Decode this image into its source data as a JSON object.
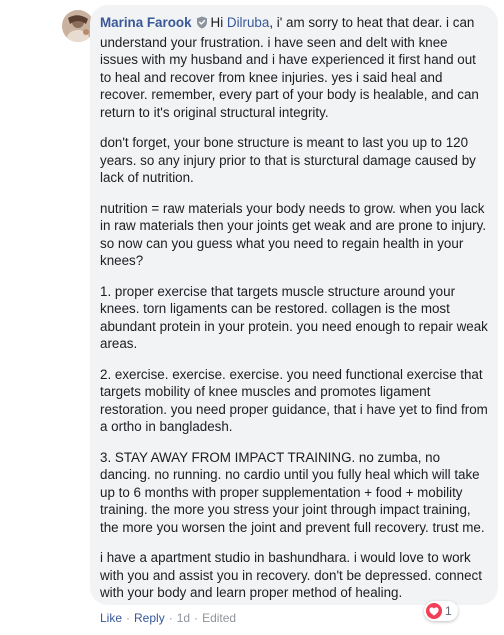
{
  "comment": {
    "author": "Marina Farook",
    "mention": "Dilruba",
    "first_line_prefix": "Hi ",
    "first_paragraph_rest": ", i' am sorry to heat that dear. i can understand your frustration. i have seen and delt with knee issues with my husband and i have experienced it first hand out to heal and recover from knee injuries. yes i said heal and recover. remember, every part of your body is healable, and can return to it's original structural integrity.",
    "paragraphs": [
      "don't forget, your bone structure is meant to last you up to 120 years. so any injury prior to that is sturctural damage caused by lack of nutrition.",
      "nutrition = raw materials your body needs to grow. when you lack in raw materials then your joints get weak and are prone to injury. so now can you guess what you need to regain health in your knees?",
      "1. proper exercise that targets muscle structure around your knees. torn ligaments can be restored. collagen is the most abundant protein in your protein. you need enough to repair weak areas.",
      "2. exercise. exercise. exercise. you need functional exercise that targets mobility of knee muscles and promotes ligament restoration. you need proper guidance, that i have yet to find from a ortho in bangladesh.",
      "3. STAY AWAY FROM IMPACT TRAINING. no zumba, no dancing. no running. no cardio until you fully heal which will take up to 6 months with proper supplementation + food + mobility training. the more you stress your joint through impact training, the more you worsen the joint and prevent full recovery. trust me.",
      "i have a apartment studio in bashundhara. i would love to work with you and assist you in recovery. don't be depressed. connect with your body and learn proper method of healing."
    ]
  },
  "reaction": {
    "icon": "heart-icon",
    "count": "1",
    "color": "#f33e58"
  },
  "actions": {
    "like": "Like",
    "reply": "Reply",
    "time": "1d",
    "edited": "Edited",
    "separator": "·"
  },
  "badge": {
    "icon": "shield-badge-icon"
  }
}
